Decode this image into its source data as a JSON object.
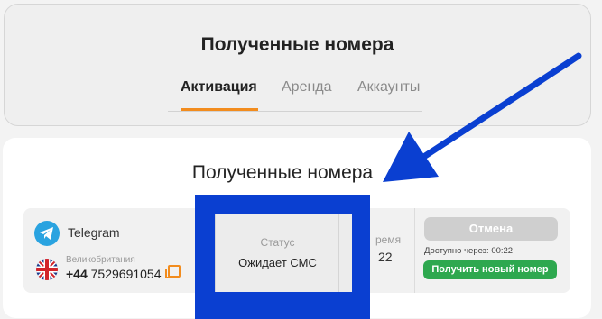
{
  "header": {
    "title": "Полученные номера",
    "tabs": [
      "Активация",
      "Аренда",
      "Аккаунты"
    ],
    "active_tab": "Активация"
  },
  "main": {
    "title": "Полученные номера",
    "row": {
      "service": "Telegram",
      "country": "Великобритания",
      "phone_prefix": "+44",
      "phone_number": "7529691054",
      "status_label": "Статус",
      "status_value": "Ожидает СМС",
      "time_label_partial": "ремя",
      "time_partial": "22",
      "cancel_label": "Отмена",
      "available_text": "Доступно через: 00:22",
      "new_number_label": "Получить новый номер"
    }
  },
  "colors": {
    "accent": "#f28c1e",
    "highlight": "#0a3fd1",
    "success": "#2ea84f",
    "telegram": "#2aa3e0"
  },
  "icons": [
    "telegram-icon",
    "uk-flag-icon",
    "copy-icon"
  ]
}
